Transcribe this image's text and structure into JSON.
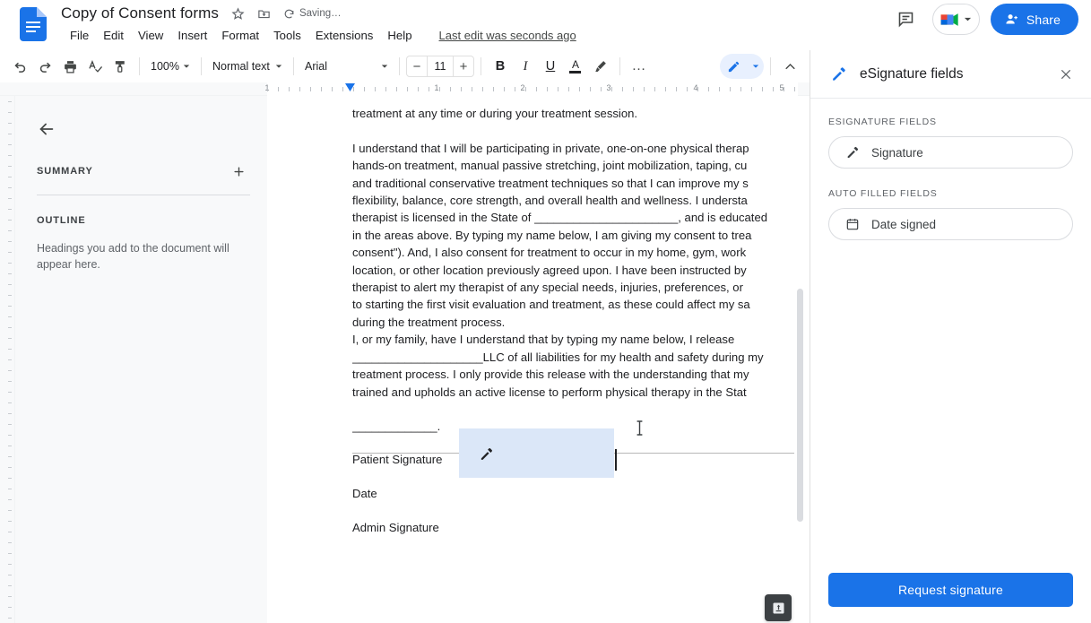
{
  "header": {
    "doc_title": "Copy of Consent forms",
    "star_icon": "star-icon",
    "move_icon": "move-to-folder-icon",
    "saving_text": "Saving…",
    "menus": [
      "File",
      "Edit",
      "View",
      "Insert",
      "Format",
      "Tools",
      "Extensions",
      "Help"
    ],
    "last_edit": "Last edit was seconds ago",
    "comment_icon": "comment-icon",
    "meet_icon": "google-meet-icon",
    "share_label": "Share",
    "share_color": "#1a73e8"
  },
  "toolbar": {
    "undo": "undo-icon",
    "redo": "redo-icon",
    "print": "print-icon",
    "spellcheck": "spellcheck-icon",
    "paint_format": "paint-format-icon",
    "zoom_value": "100%",
    "style_value": "Normal text",
    "font_value": "Arial",
    "font_size": "11",
    "decrease": "−",
    "increase": "+",
    "bold": "B",
    "italic": "I",
    "underline": "U",
    "text_color": "A",
    "highlight": "highlight-pen-icon",
    "more": "…",
    "edit_mode": "edit-pencil-icon",
    "collapse": "collapse-chevron-icon"
  },
  "ruler": {
    "numbers": [
      "1",
      "1",
      "2",
      "3",
      "4",
      "5"
    ]
  },
  "outline_panel": {
    "back_icon": "back-arrow-icon",
    "summary_label": "SUMMARY",
    "add_icon": "plus-icon",
    "outline_label": "OUTLINE",
    "outline_hint": "Headings you add to the document will appear here."
  },
  "document": {
    "lines": [
      "treatment at any time or during your treatment session.",
      "",
      "I understand that I will be participating in private, one-on-one physical therap",
      "hands-on treatment, manual passive stretching, joint mobilization, taping, cu",
      "and traditional conservative treatment techniques so that I can improve my s",
      "flexibility, balance, core strength, and overall health and wellness.  I understa",
      "therapist is licensed in the State of ______________________, and is educated",
      "in the areas above. By typing my name below, I am giving my consent to trea",
      "consent\"). And, I also consent for treatment to occur in my home, gym, work",
      "location, or other location previously agreed upon. I have been instructed by",
      "therapist to alert my therapist of any special needs, injuries, preferences, or",
      "to starting the first visit evaluation and treatment, as these could affect my sa",
      "during the treatment process.",
      "I, or my family, have I understand that by typing my name below, I release",
      "____________________LLC of all liabilities for my health and safety during my",
      "treatment process. I only provide this release with the understanding that my",
      "trained and upholds an active license to perform physical therapy in the Stat",
      "",
      "_____________."
    ],
    "patient_signature_label": "Patient Signature",
    "date_label": "Date",
    "admin_signature_label": "Admin Signature",
    "signature_field_icon": "signature-pen-icon",
    "signature_field_bg": "#dbe7f8",
    "cursor_icon": "i-beam-cursor",
    "explore_icon": "explore-icon"
  },
  "side_panel": {
    "panel_icon": "signature-pen-icon",
    "title": "eSignature fields",
    "close_icon": "close-icon",
    "sections": [
      {
        "label": "ESIGNATURE FIELDS",
        "fields": [
          {
            "icon": "signature-pen-icon",
            "label": "Signature"
          }
        ]
      },
      {
        "label": "AUTO FILLED FIELDS",
        "fields": [
          {
            "icon": "calendar-icon",
            "label": "Date signed"
          }
        ]
      }
    ],
    "request_button": "Request signature"
  }
}
